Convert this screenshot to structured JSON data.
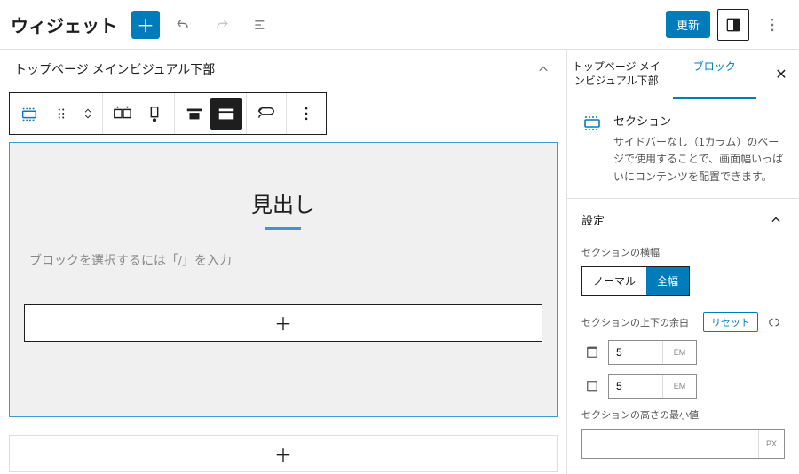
{
  "header": {
    "title": "ウィジェット",
    "update_label": "更新"
  },
  "widget_area": {
    "name": "トップページ メインビジュアル下部"
  },
  "canvas": {
    "heading": "見出し",
    "placeholder": "ブロックを選択するには「/」を入力"
  },
  "sidebar": {
    "tabs": {
      "area": "トップページ メインビジュアル下部",
      "block": "ブロック"
    },
    "block": {
      "name": "セクション",
      "desc": "サイドバーなし（1カラム）のページで使用することで、画面幅いっぱいにコンテンツを配置できます。"
    },
    "settings_label": "設定",
    "width": {
      "label": "セクションの横幅",
      "normal": "ノーマル",
      "full": "全幅"
    },
    "spacing": {
      "label": "セクションの上下の余白",
      "reset": "リセット",
      "top": "5",
      "bottom": "5",
      "unit": "EM"
    },
    "minheight": {
      "label": "セクションの高さの最小値",
      "value": "",
      "unit": "PX"
    }
  }
}
